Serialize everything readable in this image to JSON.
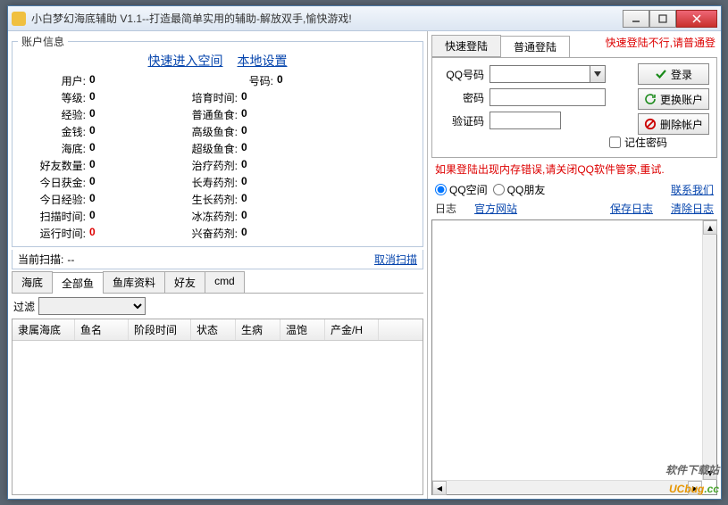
{
  "window": {
    "title": "小白梦幻海底辅助 V1.1--打造最简单实用的辅助-解放双手,愉快游戏!"
  },
  "account": {
    "legend": "账户信息",
    "quick_space": "快速进入空间",
    "local_settings": "本地设置",
    "col1": [
      {
        "label": "用户:",
        "value": "0"
      },
      {
        "label": "等级:",
        "value": "0"
      },
      {
        "label": "经验:",
        "value": "0"
      },
      {
        "label": "金钱:",
        "value": "0"
      },
      {
        "label": "海底:",
        "value": "0"
      },
      {
        "label": "好友数量:",
        "value": "0"
      },
      {
        "label": "今日获金:",
        "value": "0"
      },
      {
        "label": "今日经验:",
        "value": "0"
      },
      {
        "label": "扫描时间:",
        "value": "0"
      },
      {
        "label": "运行时间:",
        "value": "0",
        "red": true
      }
    ],
    "col2_first": {
      "label": "号码:",
      "value": "0"
    },
    "col2": [
      {
        "label": "培育时间:",
        "value": "0"
      },
      {
        "label": "普通鱼食:",
        "value": "0"
      },
      {
        "label": "高级鱼食:",
        "value": "0"
      },
      {
        "label": "超级鱼食:",
        "value": "0"
      },
      {
        "label": "治疗药剂:",
        "value": "0"
      },
      {
        "label": "长寿药剂:",
        "value": "0"
      },
      {
        "label": "生长药剂:",
        "value": "0"
      },
      {
        "label": "冰冻药剂:",
        "value": "0"
      },
      {
        "label": "兴奋药剂:",
        "value": "0"
      }
    ]
  },
  "scan": {
    "label": "当前扫描:",
    "value": "--",
    "cancel": "取消扫描"
  },
  "tabs": [
    "海底",
    "全部鱼",
    "鱼库资料",
    "好友",
    "cmd"
  ],
  "active_tab": 1,
  "filter_label": "过滤",
  "table_headers": [
    "隶属海底",
    "鱼名",
    "阶段时间",
    "状态",
    "生病",
    "温饱",
    "产金/H"
  ],
  "login": {
    "tabs": [
      "快速登陆",
      "普通登陆"
    ],
    "active": 1,
    "note": "快速登陆不行,请普通登",
    "qq_label": "QQ号码",
    "pwd_label": "密码",
    "captcha_label": "验证码",
    "login_btn": "登录",
    "switch_btn": "更换账户",
    "delete_btn": "删除帐户",
    "remember": "记住密码",
    "error": "如果登陆出现内存错误,请关闭QQ软件管家,重试."
  },
  "space": {
    "opt1": "QQ空间",
    "opt2": "QQ朋友",
    "contact": "联系我们"
  },
  "log": {
    "label": "日志",
    "official": "官方网站",
    "save": "保存日志",
    "clear": "清除日志"
  },
  "watermark": {
    "line1": "软件下载站",
    "line2a": "UCbug",
    "line2b": ".cc"
  }
}
